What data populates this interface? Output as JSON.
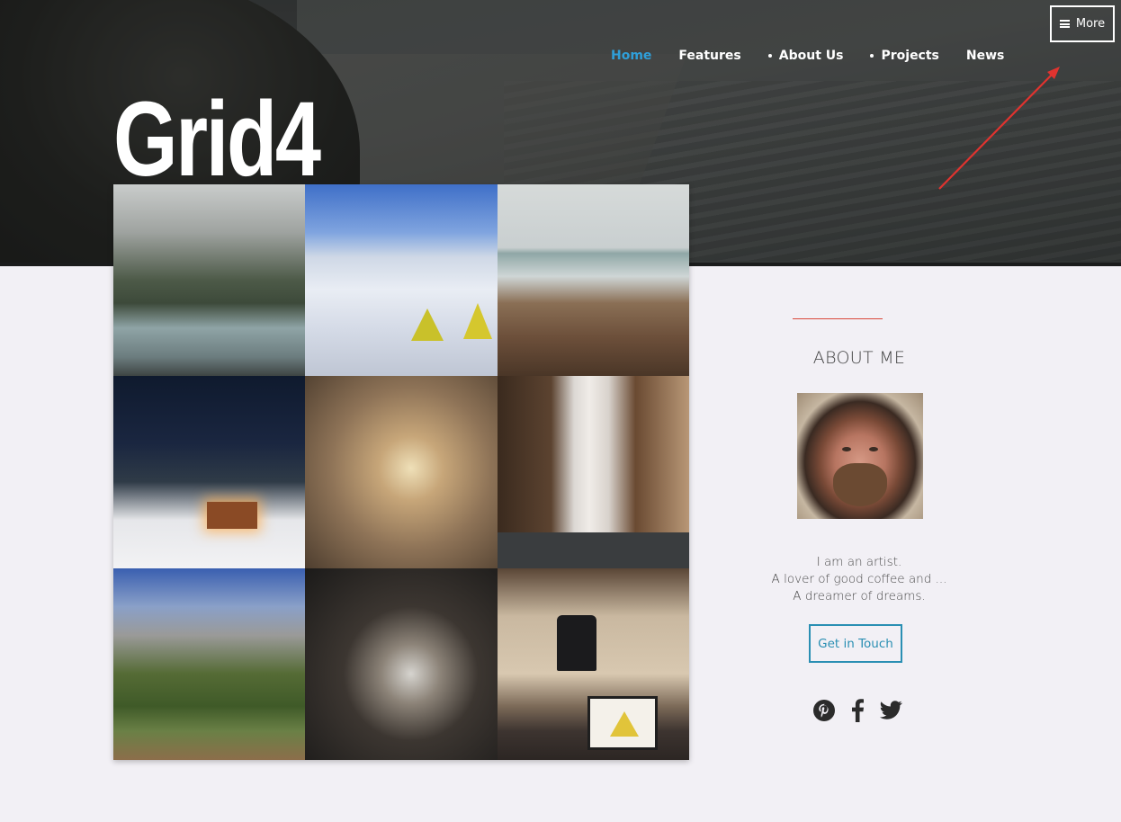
{
  "brand": {
    "logo_text": "Grid4"
  },
  "nav": {
    "items": [
      {
        "label": "Home",
        "active": true,
        "dot": false
      },
      {
        "label": "Features",
        "active": false,
        "dot": false
      },
      {
        "label": "About Us",
        "active": false,
        "dot": true
      },
      {
        "label": "Projects",
        "active": false,
        "dot": true
      },
      {
        "label": "News",
        "active": false,
        "dot": false
      }
    ],
    "more_label": "More"
  },
  "gallery": {
    "tiles": [
      {
        "icon": "river-forest-photo"
      },
      {
        "icon": "snow-mountain-tents-photo"
      },
      {
        "icon": "coastal-cliff-photo"
      },
      {
        "icon": "snowy-cabin-night-photo"
      },
      {
        "icon": "dead-trees-fog-photo"
      },
      {
        "icon": "waterfall-rainbow-photo"
      },
      {
        "icon": "valley-forest-cliff-photo"
      },
      {
        "icon": "coffee-pour-over-photo"
      },
      {
        "icon": "shop-interior-photo"
      }
    ]
  },
  "sidebar": {
    "title": "ABOUT ME",
    "bio_lines": [
      "I am an artist.",
      "A lover of good coffee and ...",
      "A dreamer of dreams."
    ],
    "cta_label": "Get in Touch",
    "social": [
      "pinterest-icon",
      "facebook-icon",
      "twitter-icon"
    ]
  },
  "colors": {
    "accent_active": "#2f9fd9",
    "cta": "#2a8fb3",
    "rule": "#d9483a",
    "annotation_arrow": "#e0332f"
  }
}
